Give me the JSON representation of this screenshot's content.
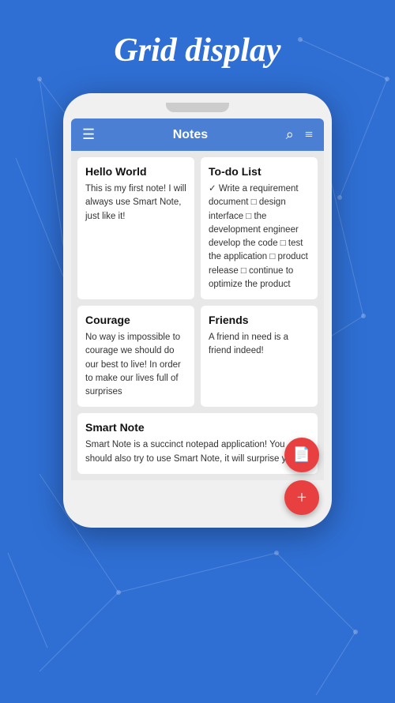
{
  "page": {
    "title": "Grid display",
    "background_color": "#2f6fd4"
  },
  "app_bar": {
    "title": "Notes",
    "menu_icon": "☰",
    "search_icon": "🔍",
    "filter_icon": "≡"
  },
  "notes": [
    {
      "id": "hello-world",
      "title": "Hello World",
      "body": "This is my first note!\nI will always use Smart Note, just like it!"
    },
    {
      "id": "todo-list",
      "title": "To-do List",
      "body": "✓ Write a requirement document\n□ design interface\n□ the development engineer develop the code\n□ test the application\n□ product release\n□ continue to optimize the product"
    },
    {
      "id": "courage",
      "title": "Courage",
      "body": "No way is impossible to courage\nwe should do our best to live!\nIn order to make our lives full of surprises"
    },
    {
      "id": "friends",
      "title": "Friends",
      "body": "A friend in need is a friend indeed!"
    },
    {
      "id": "smart-note",
      "title": "Smart Note",
      "body": "Smart Note is a succinct notepad application!\nYou should also try to use Smart Note, it will surprise you"
    }
  ],
  "fabs": {
    "doc_icon": "📄",
    "add_icon": "+"
  }
}
